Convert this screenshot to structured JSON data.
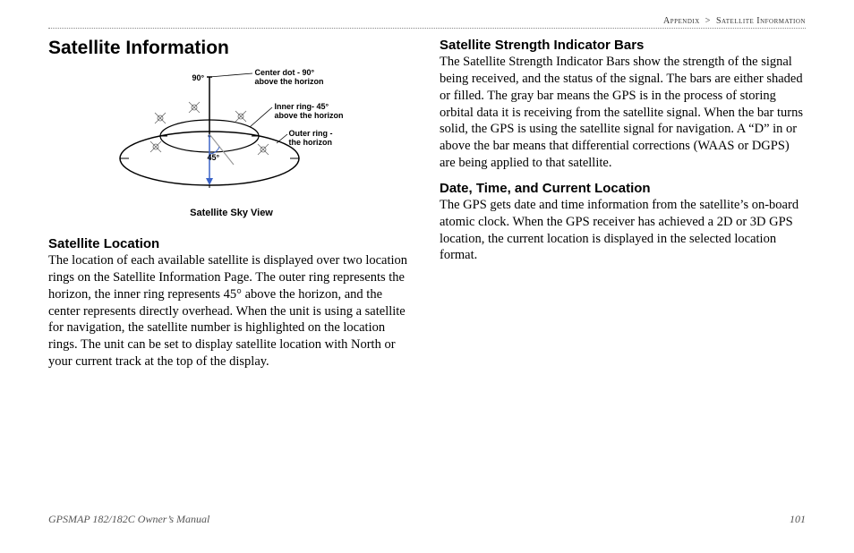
{
  "breadcrumb": {
    "section": "Appendix",
    "separator": ">",
    "page": "Satellite Information"
  },
  "title": "Satellite Information",
  "figure": {
    "label_90": "90°",
    "label_center_dot": "Center dot - 90°\nabove the horizon",
    "label_inner_ring": "Inner ring- 45°\nabove the horizon",
    "label_outer_ring": "Outer ring -\nthe horizon",
    "label_45": "45°",
    "caption": "Satellite Sky View"
  },
  "left": {
    "h_location": "Satellite Location",
    "p_location": "The location of each available satellite is displayed over two location rings on the Satellite Information Page. The outer ring represents the horizon, the inner ring represents 45° above the horizon, and the center represents directly overhead. When the unit is using a satellite for navigation, the satellite number is highlighted on the location rings. The unit can be set to display satellite location with North or your current track at the top of the display."
  },
  "right": {
    "h_bars": "Satellite Strength Indicator Bars",
    "p_bars": "The Satellite Strength Indicator Bars show the strength of the signal being received, and the status of the signal. The bars are either shaded or filled. The gray bar means the GPS is in the process of storing orbital data it is receiving from the satellite signal. When the bar turns solid, the GPS is using the satellite signal for navigation. A “D” in or above the bar means that differential corrections (WAAS or DGPS) are being applied to that satellite.",
    "h_date": "Date, Time, and Current Location",
    "p_date": "The GPS gets date and time information from the satellite’s on-board atomic clock. When the GPS receiver has achieved a 2D or 3D GPS location, the current location is displayed in the selected location format."
  },
  "footer": {
    "manual": "GPSMAP 182/182C Owner’s Manual",
    "page_num": "101"
  }
}
